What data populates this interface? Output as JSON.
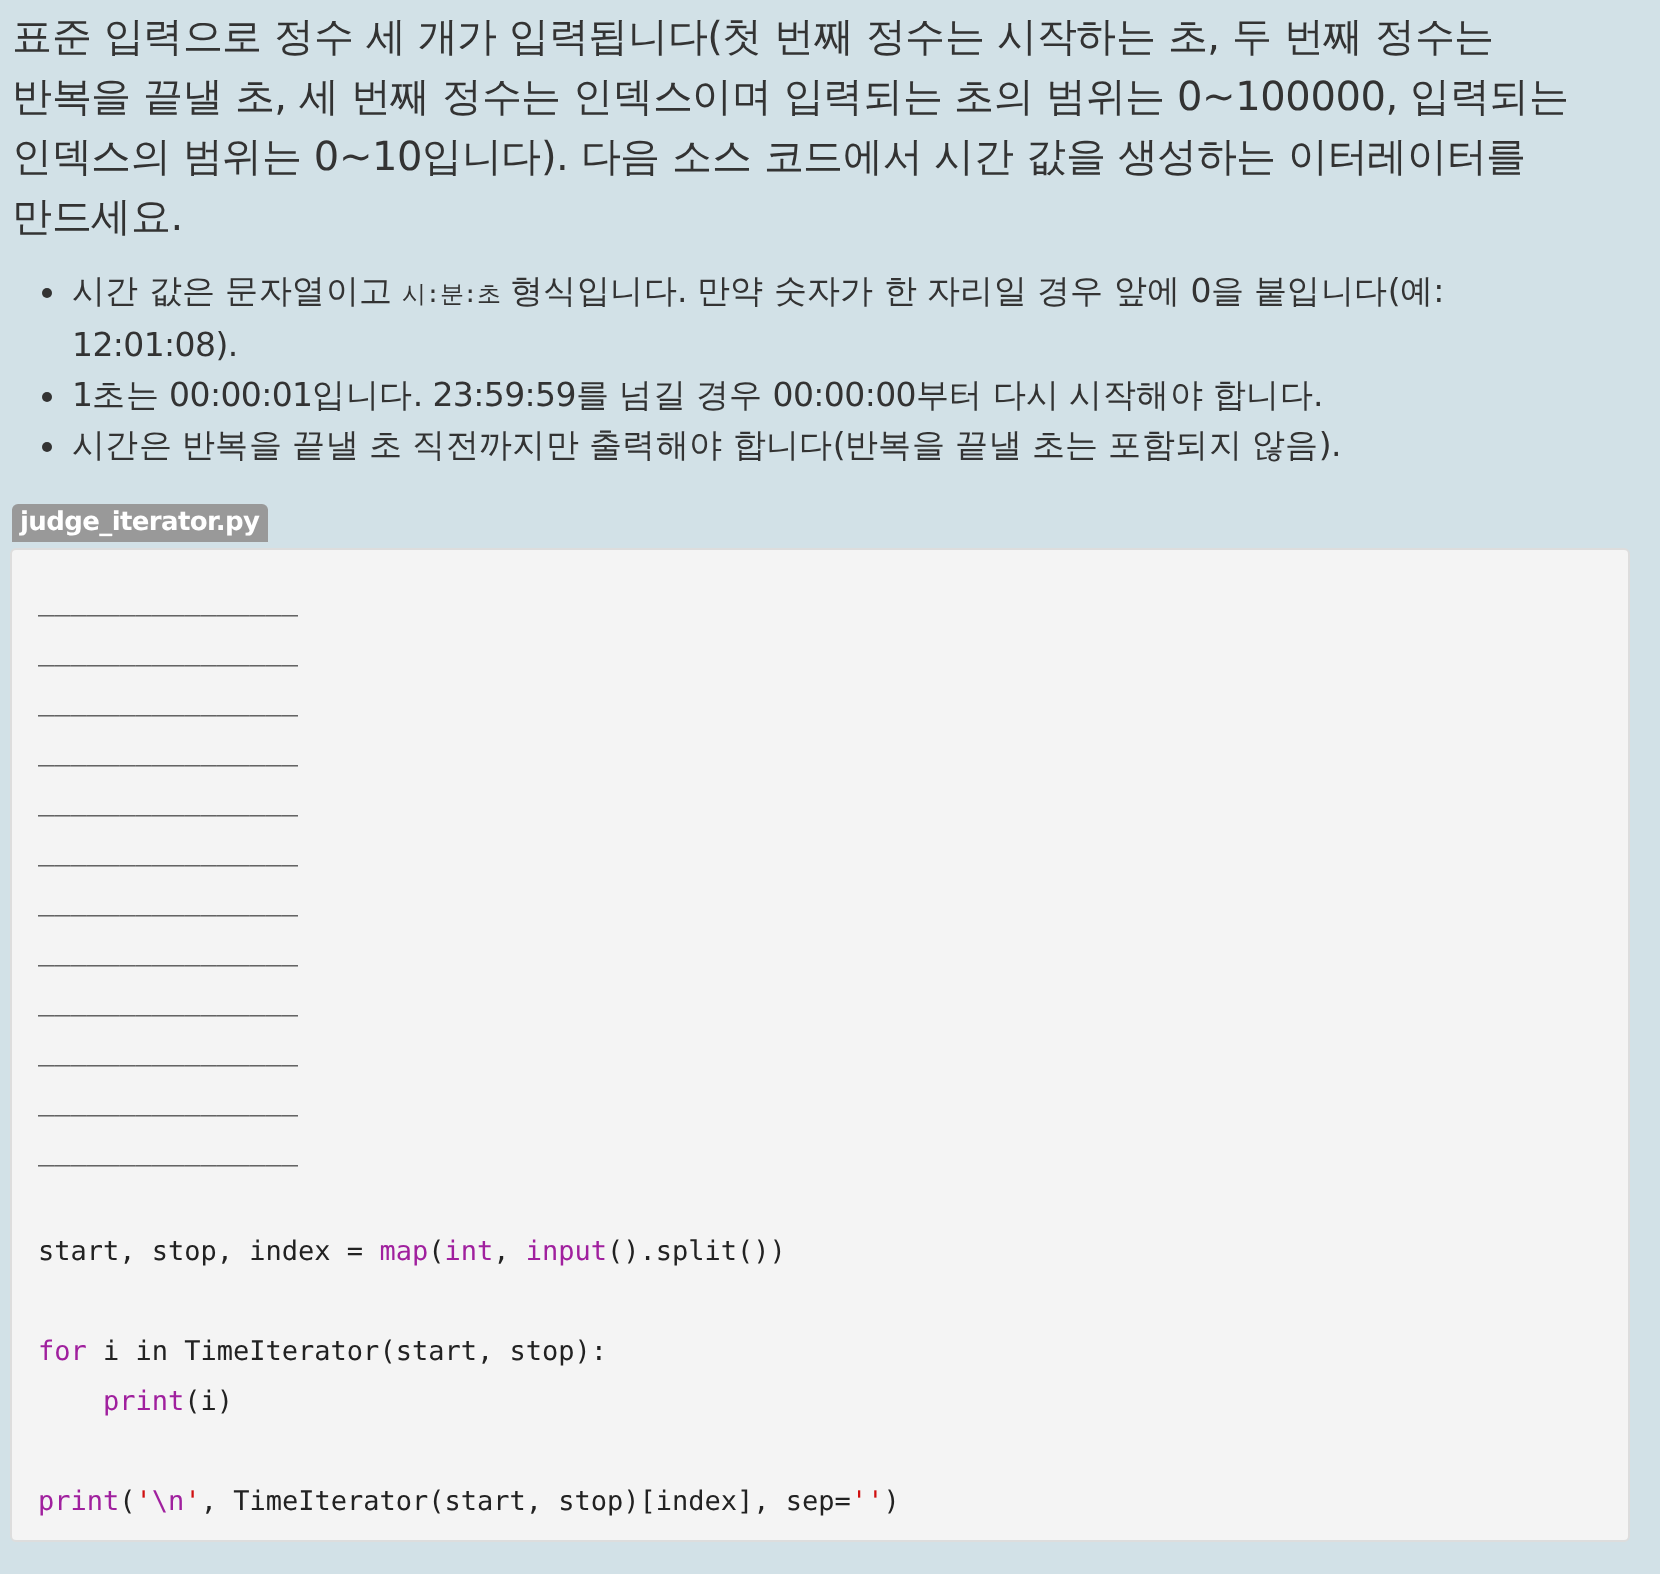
{
  "intro": "표준 입력으로 정수 세 개가 입력됩니다(첫 번째 정수는 시작하는 초, 두 번째 정수는 반복을 끝낼 초, 세 번째 정수는 인덱스이며 입력되는 초의 범위는 0~100000, 입력되는 인덱스의 범위는 0~10입니다). 다음 소스 코드에서 시간 값을 생성하는 이터레이터를 만드세요.",
  "bullets": [
    {
      "parts": [
        {
          "kind": "text",
          "text": "시간 값은 문자열이고 "
        },
        {
          "kind": "code",
          "text": "시:분:초"
        },
        {
          "kind": "text",
          "text": " 형식입니다. 만약 숫자가 한 자리일 경우 앞에 0을 붙입니다(예: 12:01:08)."
        }
      ]
    },
    {
      "parts": [
        {
          "kind": "text",
          "text": "1초는 00:00:01입니다. 23:59:59를 넘길 경우 00:00:00부터 다시 시작해야 합니다."
        }
      ]
    },
    {
      "parts": [
        {
          "kind": "text",
          "text": "시간은 반복을 끝낼 초 직전까지만 출력해야 합니다(반복을 끝낼 초는 포함되지 않음)."
        }
      ]
    }
  ],
  "file_label": "judge_iterator.py",
  "code_lines": [
    {
      "kind": "code",
      "tokens": [
        {
          "kind": "plain",
          "text": "________________"
        }
      ]
    },
    {
      "kind": "code",
      "tokens": [
        {
          "kind": "plain",
          "text": "________________"
        }
      ]
    },
    {
      "kind": "code",
      "tokens": [
        {
          "kind": "plain",
          "text": "________________"
        }
      ]
    },
    {
      "kind": "code",
      "tokens": [
        {
          "kind": "plain",
          "text": "________________"
        }
      ]
    },
    {
      "kind": "code",
      "tokens": [
        {
          "kind": "plain",
          "text": "________________"
        }
      ]
    },
    {
      "kind": "code",
      "tokens": [
        {
          "kind": "plain",
          "text": "________________"
        }
      ]
    },
    {
      "kind": "code",
      "tokens": [
        {
          "kind": "plain",
          "text": "________________"
        }
      ]
    },
    {
      "kind": "code",
      "tokens": [
        {
          "kind": "plain",
          "text": "________________"
        }
      ]
    },
    {
      "kind": "code",
      "tokens": [
        {
          "kind": "plain",
          "text": "________________"
        }
      ]
    },
    {
      "kind": "code",
      "tokens": [
        {
          "kind": "plain",
          "text": "________________"
        }
      ]
    },
    {
      "kind": "code",
      "tokens": [
        {
          "kind": "plain",
          "text": "________________"
        }
      ]
    },
    {
      "kind": "code",
      "tokens": [
        {
          "kind": "plain",
          "text": "________________"
        }
      ]
    },
    {
      "kind": "blank"
    },
    {
      "kind": "code",
      "tokens": [
        {
          "kind": "plain",
          "text": "start, stop, index = "
        },
        {
          "kind": "builtin",
          "text": "map"
        },
        {
          "kind": "plain",
          "text": "("
        },
        {
          "kind": "builtin",
          "text": "int"
        },
        {
          "kind": "plain",
          "text": ", "
        },
        {
          "kind": "builtin",
          "text": "input"
        },
        {
          "kind": "plain",
          "text": "().split())"
        }
      ]
    },
    {
      "kind": "blank"
    },
    {
      "kind": "code",
      "tokens": [
        {
          "kind": "builtin",
          "text": "for"
        },
        {
          "kind": "plain",
          "text": " i in TimeIterator(start, stop):"
        }
      ]
    },
    {
      "kind": "code",
      "indented": true,
      "tokens": [
        {
          "kind": "builtin",
          "text": "print"
        },
        {
          "kind": "plain",
          "text": "(i)"
        }
      ]
    },
    {
      "kind": "blank"
    },
    {
      "kind": "code",
      "tokens": [
        {
          "kind": "builtin",
          "text": "print"
        },
        {
          "kind": "plain",
          "text": "("
        },
        {
          "kind": "string",
          "text": "'"
        },
        {
          "kind": "builtin",
          "text": "\\n"
        },
        {
          "kind": "string",
          "text": "'"
        },
        {
          "kind": "plain",
          "text": ", TimeIterator(start, stop)[index], sep="
        },
        {
          "kind": "string",
          "text": "''"
        },
        {
          "kind": "plain",
          "text": ")"
        }
      ]
    }
  ]
}
